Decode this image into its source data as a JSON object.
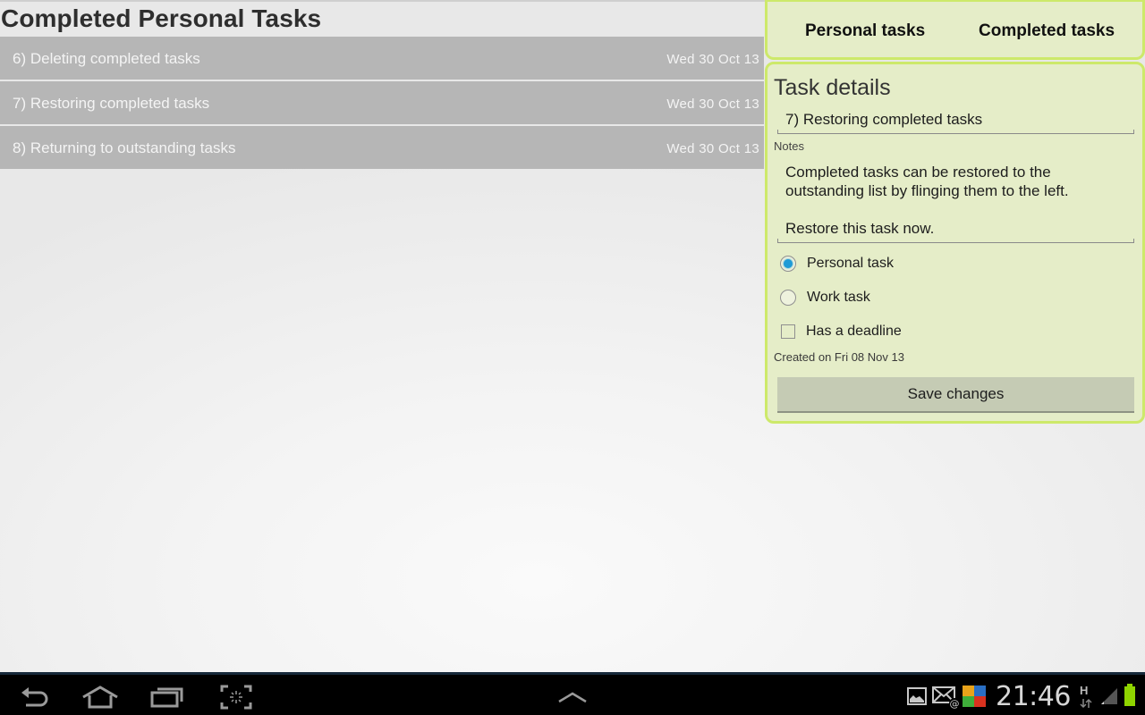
{
  "page": {
    "title": "Completed Personal Tasks"
  },
  "tasks": [
    {
      "title": "6) Deleting completed tasks",
      "date": "Wed 30 Oct 13"
    },
    {
      "title": "7) Restoring completed tasks",
      "date": "Wed 30 Oct 13"
    },
    {
      "title": "8) Returning to outstanding tasks",
      "date": "Wed 30 Oct 13"
    }
  ],
  "tabs": {
    "personal": "Personal tasks",
    "completed": "Completed tasks"
  },
  "details": {
    "heading": "Task details",
    "title_value": "7) Restoring completed tasks",
    "notes_label": "Notes",
    "notes_value": "Completed tasks can be restored to the outstanding list by flinging them to the left.\n\nRestore this task now.",
    "options": {
      "personal_task": {
        "label": "Personal task",
        "checked": true
      },
      "work_task": {
        "label": "Work task",
        "checked": false
      },
      "deadline": {
        "label": "Has a deadline",
        "checked": false
      }
    },
    "created": "Created on Fri 08 Nov 13",
    "save_label": "Save changes"
  },
  "system_bar": {
    "clock": "21:46",
    "network_type": "H",
    "nav_icons": [
      "back-icon",
      "home-icon",
      "recent-apps-icon",
      "screenshot-icon",
      "up-chevron-icon"
    ],
    "status_icons": [
      "gallery-icon",
      "email-icon",
      "avg-antivirus-icon",
      "data-transfer-icon",
      "signal-icon",
      "battery-icon"
    ],
    "battery_color": "#8fd400"
  },
  "colors": {
    "panel_bg": "#e5edc8",
    "panel_border": "#cde96a",
    "list_row": "#b6b6b6",
    "radio_accent": "#1f9bd6"
  }
}
